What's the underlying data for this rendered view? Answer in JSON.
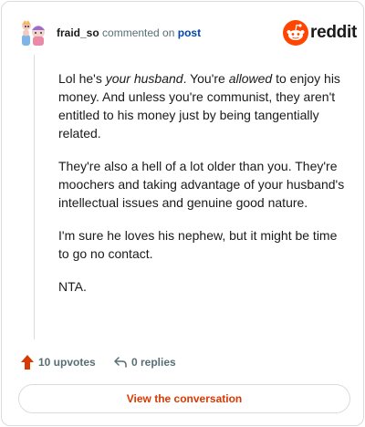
{
  "comment": {
    "username": "fraid_so",
    "action_text": "commented on",
    "post_link_label": "post",
    "body_html": [
      "Lol he's <em>your husband</em>. You're <em>allowed</em> to enjoy his money. And unless you're communist, they aren't entitled to his money just by being tangentially related.",
      "They're also a hell of a lot older than you. They're moochers and taking advantage of your husband's intellectual issues and genuine good nature.",
      "I'm sure he loves his nephew, but it might be time to go no contact.",
      "NTA."
    ]
  },
  "brand": {
    "wordmark": "reddit",
    "color": "#ff4500"
  },
  "stats": {
    "upvotes_label": "10 upvotes",
    "replies_label": "0 replies"
  },
  "cta": {
    "label": "View the conversation"
  },
  "icons": {
    "upvote": "upvote-arrow-icon",
    "reply": "reply-arrow-icon",
    "avatar": "avatar"
  }
}
